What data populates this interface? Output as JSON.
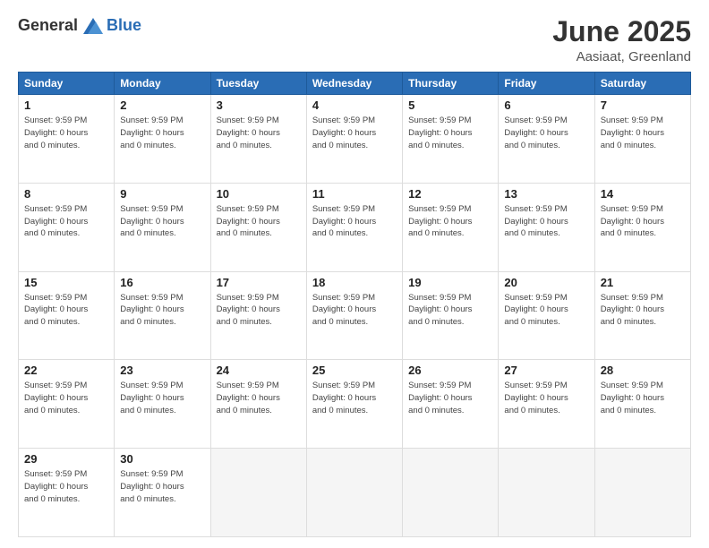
{
  "logo": {
    "general": "General",
    "blue": "Blue"
  },
  "header": {
    "month": "June 2025",
    "location": "Aasiaat, Greenland"
  },
  "days_of_week": [
    "Sunday",
    "Monday",
    "Tuesday",
    "Wednesday",
    "Thursday",
    "Friday",
    "Saturday"
  ],
  "cell_info": "Sunset: 9:59 PM\nDaylight: 0 hours and 0 minutes.",
  "weeks": [
    [
      {
        "num": "1",
        "info": "Sunset: 9:59 PM\nDaylight: 0 hours\nand 0 minutes."
      },
      {
        "num": "2",
        "info": "Sunset: 9:59 PM\nDaylight: 0 hours\nand 0 minutes."
      },
      {
        "num": "3",
        "info": "Sunset: 9:59 PM\nDaylight: 0 hours\nand 0 minutes."
      },
      {
        "num": "4",
        "info": "Sunset: 9:59 PM\nDaylight: 0 hours\nand 0 minutes."
      },
      {
        "num": "5",
        "info": "Sunset: 9:59 PM\nDaylight: 0 hours\nand 0 minutes."
      },
      {
        "num": "6",
        "info": "Sunset: 9:59 PM\nDaylight: 0 hours\nand 0 minutes."
      },
      {
        "num": "7",
        "info": "Sunset: 9:59 PM\nDaylight: 0 hours\nand 0 minutes."
      }
    ],
    [
      {
        "num": "8",
        "info": "Sunset: 9:59 PM\nDaylight: 0 hours\nand 0 minutes."
      },
      {
        "num": "9",
        "info": "Sunset: 9:59 PM\nDaylight: 0 hours\nand 0 minutes."
      },
      {
        "num": "10",
        "info": "Sunset: 9:59 PM\nDaylight: 0 hours\nand 0 minutes."
      },
      {
        "num": "11",
        "info": "Sunset: 9:59 PM\nDaylight: 0 hours\nand 0 minutes."
      },
      {
        "num": "12",
        "info": "Sunset: 9:59 PM\nDaylight: 0 hours\nand 0 minutes."
      },
      {
        "num": "13",
        "info": "Sunset: 9:59 PM\nDaylight: 0 hours\nand 0 minutes."
      },
      {
        "num": "14",
        "info": "Sunset: 9:59 PM\nDaylight: 0 hours\nand 0 minutes."
      }
    ],
    [
      {
        "num": "15",
        "info": "Sunset: 9:59 PM\nDaylight: 0 hours\nand 0 minutes."
      },
      {
        "num": "16",
        "info": "Sunset: 9:59 PM\nDaylight: 0 hours\nand 0 minutes."
      },
      {
        "num": "17",
        "info": "Sunset: 9:59 PM\nDaylight: 0 hours\nand 0 minutes."
      },
      {
        "num": "18",
        "info": "Sunset: 9:59 PM\nDaylight: 0 hours\nand 0 minutes."
      },
      {
        "num": "19",
        "info": "Sunset: 9:59 PM\nDaylight: 0 hours\nand 0 minutes."
      },
      {
        "num": "20",
        "info": "Sunset: 9:59 PM\nDaylight: 0 hours\nand 0 minutes."
      },
      {
        "num": "21",
        "info": "Sunset: 9:59 PM\nDaylight: 0 hours\nand 0 minutes."
      }
    ],
    [
      {
        "num": "22",
        "info": "Sunset: 9:59 PM\nDaylight: 0 hours\nand 0 minutes."
      },
      {
        "num": "23",
        "info": "Sunset: 9:59 PM\nDaylight: 0 hours\nand 0 minutes."
      },
      {
        "num": "24",
        "info": "Sunset: 9:59 PM\nDaylight: 0 hours\nand 0 minutes."
      },
      {
        "num": "25",
        "info": "Sunset: 9:59 PM\nDaylight: 0 hours\nand 0 minutes."
      },
      {
        "num": "26",
        "info": "Sunset: 9:59 PM\nDaylight: 0 hours\nand 0 minutes."
      },
      {
        "num": "27",
        "info": "Sunset: 9:59 PM\nDaylight: 0 hours\nand 0 minutes."
      },
      {
        "num": "28",
        "info": "Sunset: 9:59 PM\nDaylight: 0 hours\nand 0 minutes."
      }
    ],
    [
      {
        "num": "29",
        "info": "Sunset: 9:59 PM\nDaylight: 0 hours\nand 0 minutes."
      },
      {
        "num": "30",
        "info": "Sunset: 9:59 PM\nDaylight: 0 hours\nand 0 minutes."
      },
      {
        "num": "",
        "info": ""
      },
      {
        "num": "",
        "info": ""
      },
      {
        "num": "",
        "info": ""
      },
      {
        "num": "",
        "info": ""
      },
      {
        "num": "",
        "info": ""
      }
    ]
  ]
}
